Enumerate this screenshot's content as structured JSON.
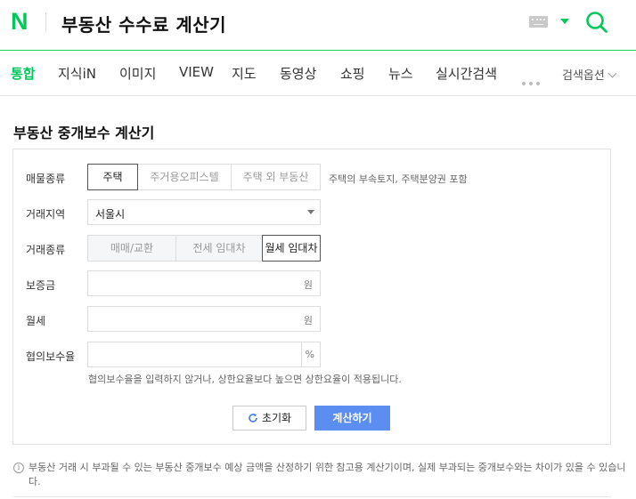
{
  "header": {
    "logo": "N",
    "query": "부동산 수수료 계산기",
    "icons": {
      "logo": "naver-logo",
      "keyboard": "keyboard-icon",
      "caret": "caret-down-icon",
      "search": "search-icon"
    },
    "colors": {
      "brand": "#03c75a"
    }
  },
  "nav": {
    "tabs": [
      {
        "label": "통합",
        "active": true
      },
      {
        "label": "지식iN"
      },
      {
        "label": "이미지"
      },
      {
        "label": "VIEW"
      },
      {
        "label": "지도"
      },
      {
        "label": "동영상"
      },
      {
        "label": "쇼핑"
      },
      {
        "label": "뉴스"
      },
      {
        "label": "실시간검색"
      }
    ],
    "more_icon": "more-dots-icon",
    "options_label": "검색옵션"
  },
  "calculator": {
    "title": "부동산 중개보수 계산기",
    "property_type": {
      "label": "매물종류",
      "options": [
        "주택",
        "주거용오피스텔",
        "주택 외 부동산"
      ],
      "selected": "주택",
      "hint": "주택의 부속토지, 주택분양권 포함"
    },
    "region": {
      "label": "거래지역",
      "value": "서울시"
    },
    "deal_type": {
      "label": "거래종류",
      "options": [
        "매매/교환",
        "전세 임대차",
        "월세 임대차"
      ],
      "selected": "월세 임대차"
    },
    "deposit": {
      "label": "보증금",
      "value": "",
      "unit": "원"
    },
    "monthly": {
      "label": "월세",
      "value": "",
      "unit": "원"
    },
    "rate": {
      "label": "협의보수율",
      "value": "",
      "unit": "%",
      "hint": "협의보수율을 입력하지 않거나, 상한요율보다 높으면 상한요율이 적용됩니다."
    },
    "buttons": {
      "reset": "초기화",
      "calculate": "계산하기"
    },
    "colors": {
      "primary_button": "#5c8ef2"
    }
  },
  "footnote": {
    "icon": "info-icon",
    "text": "부동산 거래 시 부과될 수 있는 부동산 중개보수 예상 금액을 산정하기 위한 참고용 계산기이며, 실제 부과되는 중개보수와는 차이가 있을 수 있습니다."
  }
}
